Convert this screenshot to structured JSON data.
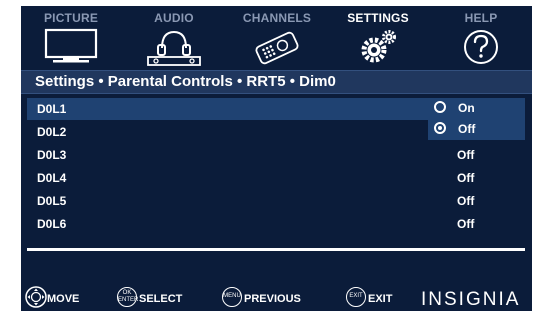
{
  "tabs": [
    {
      "label": "PICTURE",
      "icon": "tv-icon",
      "active": false
    },
    {
      "label": "AUDIO",
      "icon": "headphones-icon",
      "active": false
    },
    {
      "label": "CHANNELS",
      "icon": "remote-icon",
      "active": false
    },
    {
      "label": "SETTINGS",
      "icon": "gears-icon",
      "active": true
    },
    {
      "label": "HELP",
      "icon": "help-icon",
      "active": false
    }
  ],
  "breadcrumb": "Settings • Parental Controls  • RRT5 • Dim0",
  "rows": [
    {
      "label": "D0L1",
      "value": ""
    },
    {
      "label": "D0L2",
      "value": ""
    },
    {
      "label": "D0L3",
      "value": "Off"
    },
    {
      "label": "D0L4",
      "value": "Off"
    },
    {
      "label": "D0L5",
      "value": "Off"
    },
    {
      "label": "D0L6",
      "value": "Off"
    }
  ],
  "dropdown": {
    "options": [
      {
        "label": "On",
        "selected": false
      },
      {
        "label": "Off",
        "selected": true
      }
    ]
  },
  "footer": {
    "move": "MOVE",
    "select_btn": "OK ENTER",
    "select": "SELECT",
    "menu_btn": "MENU",
    "previous": "PREVIOUS",
    "exit_btn": "EXIT",
    "exit": "EXIT",
    "brand": "INSIGNIA"
  },
  "colors": {
    "background": "#0b1c3a",
    "highlight": "#1f4272",
    "title_bar": "#20375e",
    "inactive_tab": "#8a98b3"
  }
}
